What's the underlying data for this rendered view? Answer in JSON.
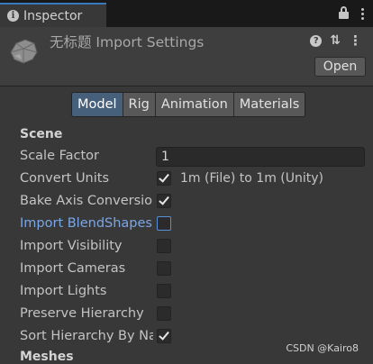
{
  "window": {
    "tab_label": "Inspector",
    "tab_info_glyph": "i",
    "tab_icons": [
      "lock-icon",
      "more-options-icon"
    ]
  },
  "header": {
    "title": "无标题 Import Settings",
    "help_glyph": "?",
    "settings_glyph": "⇅",
    "menu_glyph": "⋮",
    "open_label": "Open",
    "icons": [
      "asset-model-icon",
      "help-icon",
      "preset-icon",
      "context-menu-icon"
    ]
  },
  "mode_tabs": [
    {
      "label": "Model",
      "active": true
    },
    {
      "label": "Rig",
      "active": false
    },
    {
      "label": "Animation",
      "active": false
    },
    {
      "label": "Materials",
      "active": false
    }
  ],
  "scene": {
    "section_title": "Scene",
    "scale_factor": {
      "label": "Scale Factor",
      "value": "1"
    },
    "convert_units": {
      "label": "Convert Units",
      "checked": true,
      "detail": "1m (File) to 1m (Unity)"
    },
    "bake_axis": {
      "label": "Bake Axis Conversion",
      "checked": true
    },
    "import_blendshapes": {
      "label": "Import BlendShapes",
      "checked": false
    },
    "import_visibility": {
      "label": "Import Visibility",
      "checked": false
    },
    "import_cameras": {
      "label": "Import Cameras",
      "checked": false
    },
    "import_lights": {
      "label": "Import Lights",
      "checked": false
    },
    "preserve_hierarchy": {
      "label": "Preserve Hierarchy",
      "checked": false
    },
    "sort_hierarchy": {
      "label": "Sort Hierarchy By Name",
      "checked": true
    }
  },
  "meshes": {
    "section_title": "Meshes"
  },
  "watermark": "CSDN @Kairo8",
  "colors": {
    "accent": "#3a79bb",
    "active_tab": "#46607c",
    "highlight_label": "#7ba7e6",
    "background": "#383838"
  }
}
